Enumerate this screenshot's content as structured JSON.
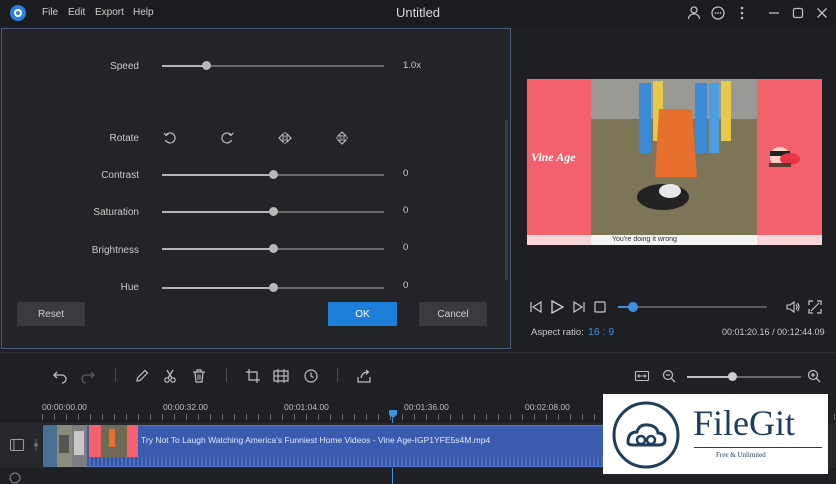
{
  "app": {
    "title": "Untitled",
    "menu": [
      "File",
      "Edit",
      "Export",
      "Help"
    ]
  },
  "adjust_panel": {
    "speed": {
      "label": "Speed",
      "value_text": "1.0x",
      "level": 0.2
    },
    "rotate": {
      "label": "Rotate"
    },
    "contrast": {
      "label": "Contrast",
      "value_text": "0",
      "level": 0.5
    },
    "saturation": {
      "label": "Saturation",
      "value_text": "0",
      "level": 0.5
    },
    "brightness": {
      "label": "Brightness",
      "value_text": "0",
      "level": 0.5
    },
    "hue": {
      "label": "Hue",
      "value_text": "0",
      "level": 0.5
    },
    "reset_label": "Reset",
    "ok_label": "OK",
    "cancel_label": "Cancel"
  },
  "preview": {
    "overlay_left": "Vine Age",
    "subtitle": "You're doing it wrong",
    "aspect_label": "Aspect ratio:",
    "aspect_value": "16 : 9",
    "time_current": "00:01:20.16",
    "time_total": "00:12:44.09",
    "time_separator": "/",
    "progress": 0.1
  },
  "timeline": {
    "marks": [
      "00:00:00.00",
      "00:00:32.00",
      "00:01:04.00",
      "00:01:36.00",
      "00:02:08.00"
    ],
    "clip_title": "Try Not To Laugh Watching America's Funniest Home Videos - Vine Age-IGP1YFE5s4M.mp4",
    "zoom_level": 0.4
  },
  "watermark": {
    "brand": "FileGit",
    "tagline": "Free & Unlimited"
  },
  "colors": {
    "accent": "#1e7fd8",
    "clip": "#3a5bb0",
    "video_bg": "#f2616c"
  }
}
